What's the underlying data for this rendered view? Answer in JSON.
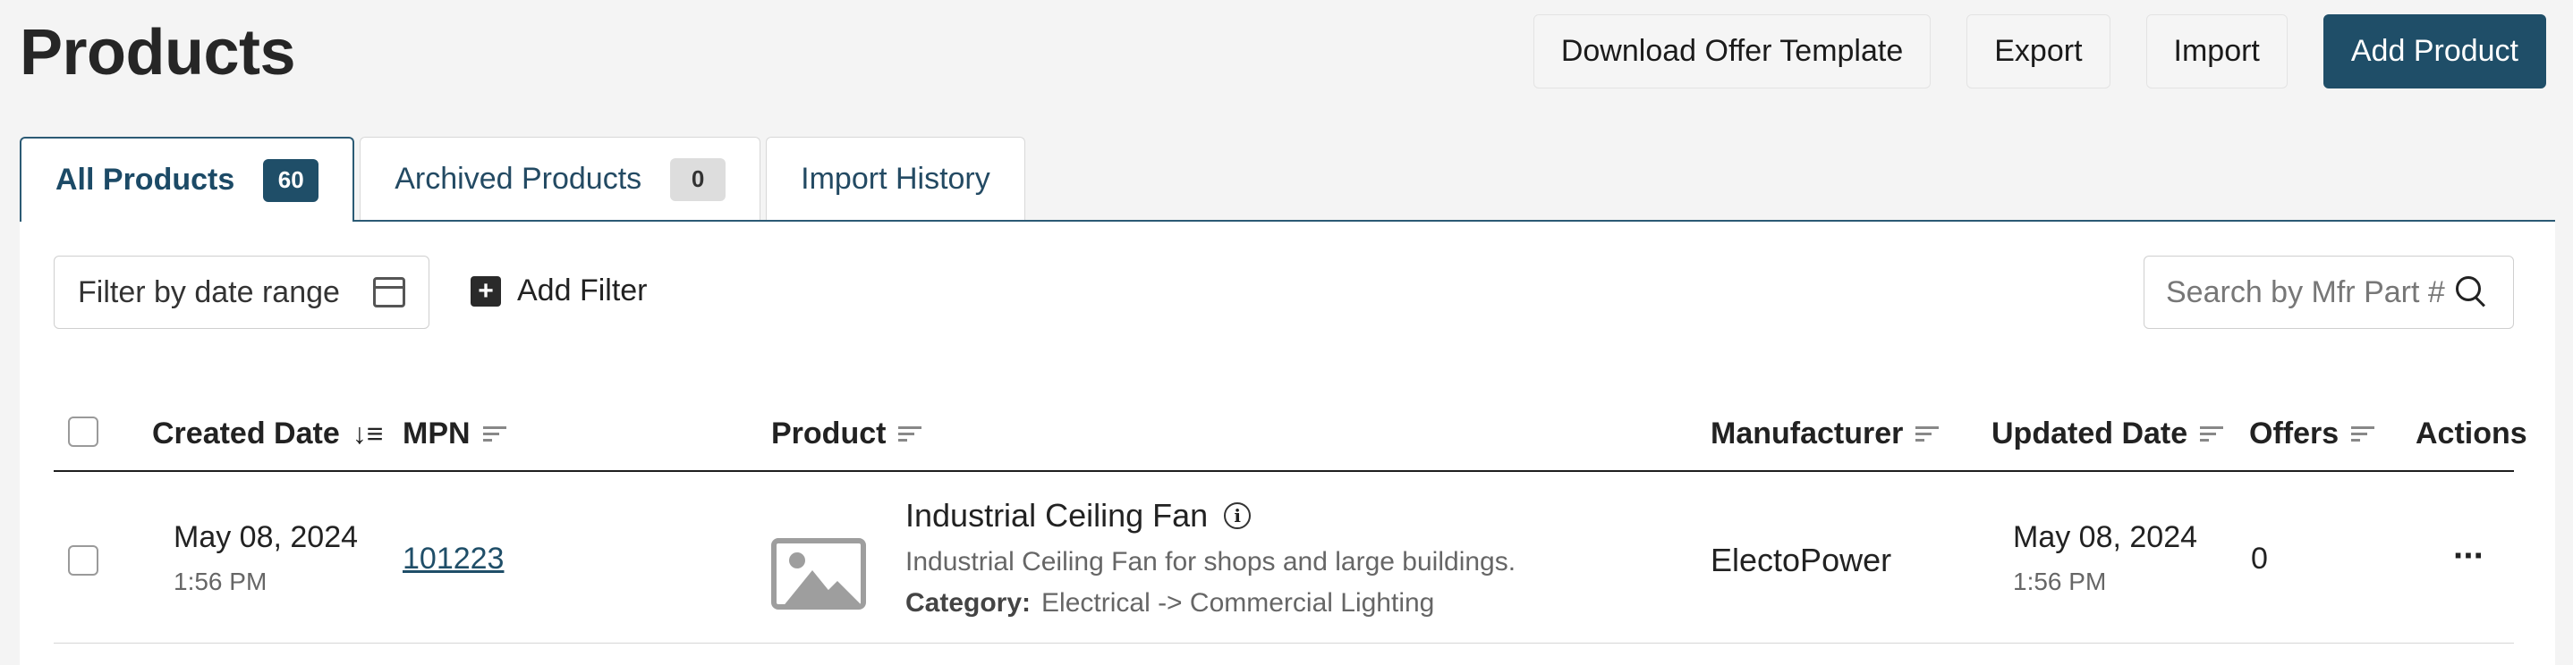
{
  "page": {
    "title": "Products"
  },
  "header_actions": {
    "download_template": "Download Offer Template",
    "export": "Export",
    "import": "Import",
    "add_product": "Add Product"
  },
  "tabs": [
    {
      "label": "All Products",
      "count": "60",
      "active": true
    },
    {
      "label": "Archived Products",
      "count": "0",
      "active": false
    },
    {
      "label": "Import History",
      "active": false
    }
  ],
  "filters": {
    "date_range_placeholder": "Filter by date range",
    "add_filter_label": "Add Filter",
    "search_placeholder": "Search by Mfr Part #"
  },
  "table": {
    "columns": {
      "created_date": "Created Date",
      "mpn": "MPN",
      "product": "Product",
      "manufacturer": "Manufacturer",
      "updated_date": "Updated Date",
      "offers": "Offers",
      "actions": "Actions"
    },
    "rows": [
      {
        "created_date": "May 08, 2024",
        "created_time": "1:56 PM",
        "mpn": "101223",
        "product_name": "Industrial Ceiling Fan",
        "product_desc": "Industrial Ceiling Fan for shops and large buildings.",
        "category_label": "Category:",
        "category_value": "Electrical -> Commercial Lighting",
        "manufacturer": "ElectoPower",
        "updated_date": "May 08, 2024",
        "updated_time": "1:56 PM",
        "offers": "0",
        "actions_glyph": "···"
      }
    ]
  },
  "colors": {
    "primary": "#1f4e68",
    "background": "#f4f4f4"
  }
}
